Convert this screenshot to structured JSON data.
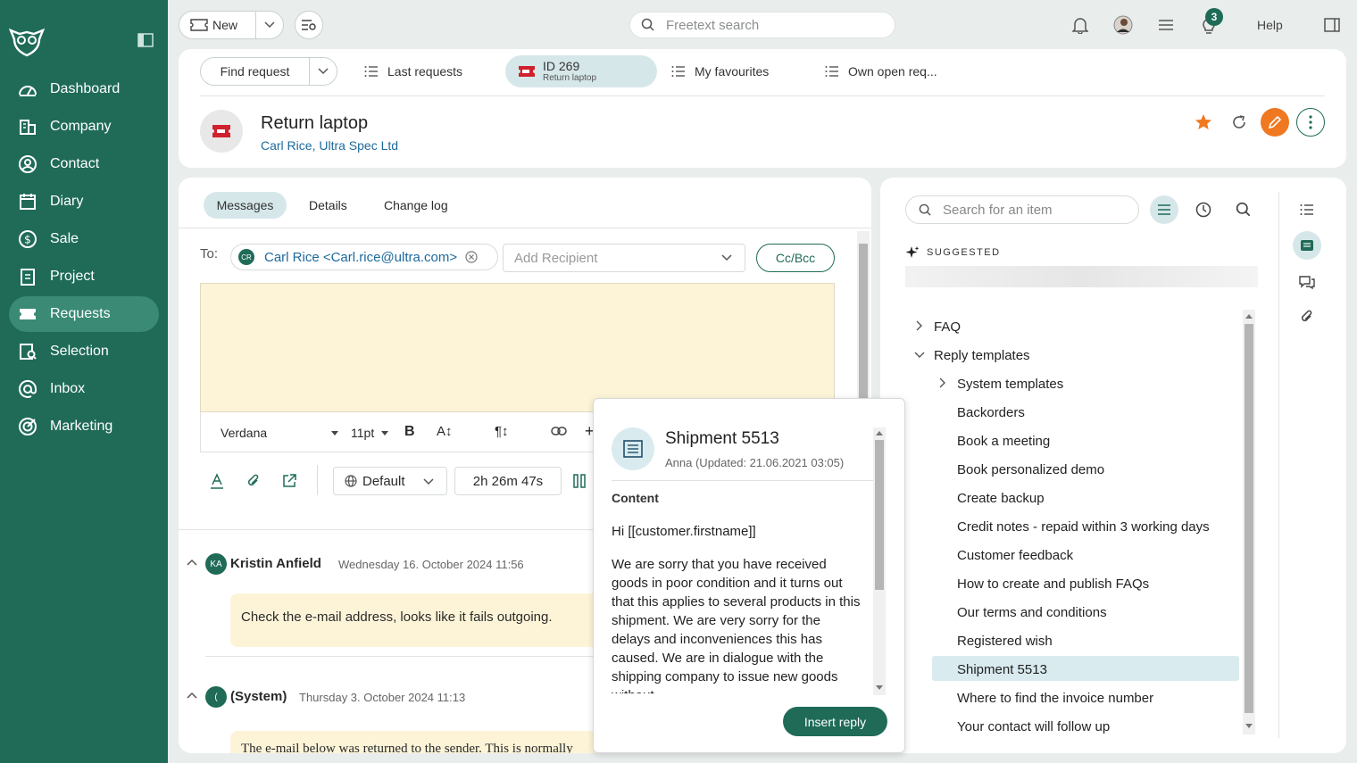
{
  "sidebar": {
    "items": [
      {
        "label": "Dashboard",
        "icon": "dashboard-icon"
      },
      {
        "label": "Company",
        "icon": "company-icon"
      },
      {
        "label": "Contact",
        "icon": "contact-icon"
      },
      {
        "label": "Diary",
        "icon": "diary-icon"
      },
      {
        "label": "Sale",
        "icon": "sale-icon"
      },
      {
        "label": "Project",
        "icon": "project-icon"
      },
      {
        "label": "Requests",
        "icon": "ticket-icon",
        "active": true
      },
      {
        "label": "Selection",
        "icon": "selection-icon"
      },
      {
        "label": "Inbox",
        "icon": "at-icon"
      },
      {
        "label": "Marketing",
        "icon": "target-icon"
      }
    ]
  },
  "topbar": {
    "new_label": "New",
    "search_placeholder": "Freetext search",
    "notification_badge": "3",
    "help_label": "Help"
  },
  "request_tabs": {
    "find_label": "Find request",
    "last_label": "Last requests",
    "current_id": "ID 269",
    "current_sub": "Return laptop",
    "favourites_label": "My favourites",
    "own_open_label": "Own open req..."
  },
  "request": {
    "title": "Return laptop",
    "contact": "Carl Rice",
    "separator": ",",
    "company": "Ultra Spec Ltd"
  },
  "messages_panel": {
    "tabs": [
      "Messages",
      "Details",
      "Change log"
    ],
    "to_label": "To:",
    "recipient_initials": "CR",
    "recipient": "Carl Rice <Carl.rice@ultra.com>",
    "add_recipient_placeholder": "Add Recipient",
    "ccbcc_label": "Cc/Bcc",
    "font": "Verdana",
    "font_size": "11pt",
    "language": "Default",
    "timer": "2h 26m 47s",
    "messages": [
      {
        "initials": "KA",
        "author": "Kristin Anfield",
        "date": "Wednesday 16. October 2024 11:56",
        "body": "Check the e-mail address, looks like it fails outgoing."
      },
      {
        "initials": "(",
        "author": "(System)",
        "date": "Thursday 3. October 2024 11:13",
        "body": "The e-mail below was returned to the sender. This is normally"
      }
    ]
  },
  "popup": {
    "title": "Shipment 5513",
    "subtitle": "Anna (Updated: 21.06.2021 03:05)",
    "content_label": "Content",
    "greeting": "Hi [[customer.firstname]]",
    "body": "We are sorry that you have received goods in poor condition and it turns out that this applies to several products in this shipment. We are very sorry for the delays and inconveniences this has caused. We are in dialogue with the shipping company to issue new goods without",
    "insert_label": "Insert reply"
  },
  "templates_panel": {
    "search_placeholder": "Search for an item",
    "suggested_label": "SUGGESTED",
    "faq": "FAQ",
    "reply_templates": "Reply templates",
    "system_templates": "System templates",
    "items": [
      "Backorders",
      "Book a meeting",
      "Book personalized demo",
      "Create backup",
      "Credit notes - repaid within 3 working days",
      "Customer feedback",
      "How to create and publish FAQs",
      "Our terms and conditions",
      "Registered wish",
      "Shipment 5513",
      "Where to find the invoice number",
      "Your contact will follow up"
    ],
    "selected": "Shipment 5513"
  },
  "colors": {
    "brand": "#1f6b58",
    "accent": "#f07820",
    "link": "#1d6a9c",
    "selected": "#d9ebef"
  }
}
